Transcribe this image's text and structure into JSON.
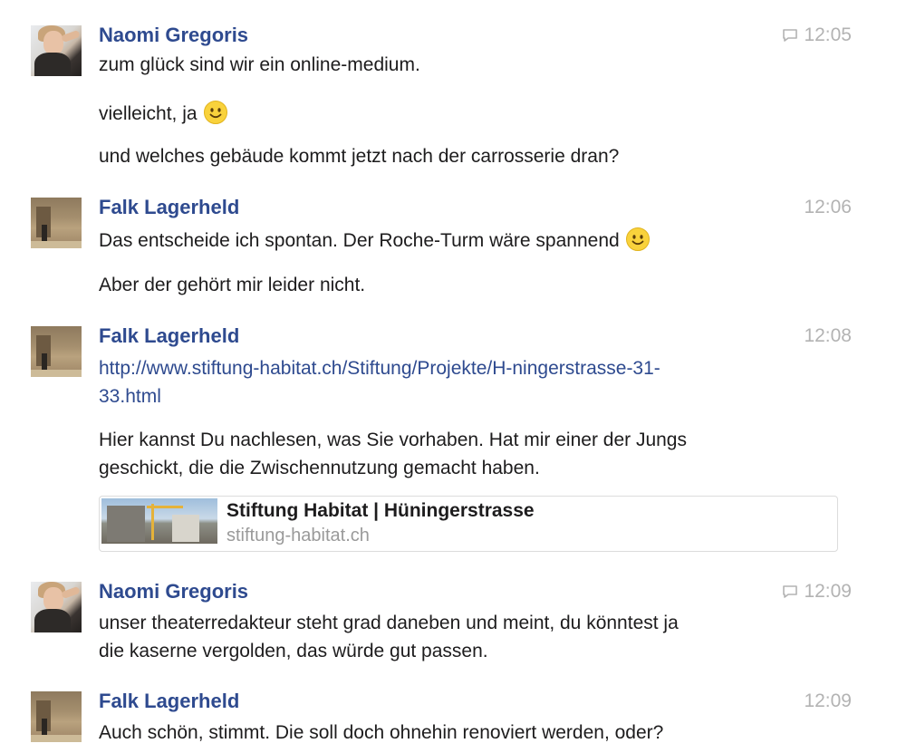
{
  "messages": [
    {
      "author": "Naomi Gregoris",
      "time": "12:05",
      "lines": [
        "zum glück sind wir ein online-medium.",
        "vielleicht, ja",
        "und welches gebäude kommt jetzt nach der carrosserie dran?"
      ]
    },
    {
      "author": "Falk Lagerheld",
      "time": "12:06",
      "lines": [
        "Das entscheide ich spontan. Der Roche-Turm wäre spannend",
        "Aber der gehört mir leider nicht."
      ]
    },
    {
      "author": "Falk Lagerheld",
      "time": "12:08",
      "link_line1": "http://www.stiftung-habitat.ch/Stiftung/Projekte/H-ningerstrasse-31-",
      "link_line2": "33.html",
      "lines": [
        "Hier kannst Du nachlesen, was Sie vorhaben. Hat mir einer der Jungs",
        "geschickt, die die Zwischennutzung gemacht haben."
      ],
      "preview": {
        "title": "Stiftung Habitat | Hüningerstrasse",
        "domain": "stiftung-habitat.ch"
      }
    },
    {
      "author": "Naomi Gregoris",
      "time": "12:09",
      "lines": [
        "unser theaterredakteur steht grad daneben und meint, du könntest ja",
        "die kaserne vergolden, das würde gut passen."
      ]
    },
    {
      "author": "Falk Lagerheld",
      "time": "12:09",
      "lines": [
        "Auch schön, stimmt. Die soll doch ohnehin renoviert werden, oder?"
      ]
    }
  ],
  "colors": {
    "author": "#2e4a8f",
    "link": "#2e4a8f",
    "timestamp": "#b3b3b3",
    "text": "#1d1c1d"
  }
}
